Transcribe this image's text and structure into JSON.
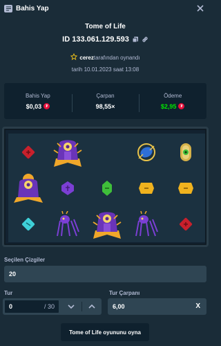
{
  "header": {
    "title": "Bahis Yap"
  },
  "game": {
    "title": "Tome of Life",
    "bet_id": "ID 133.061.129.593",
    "player_name": "cerez",
    "player_suffix": "tarafından oynandı",
    "date": "tarih 10.01.2023 saat 13:08"
  },
  "stats": {
    "bet_label": "Bahis Yap",
    "bet_value": "$0,03",
    "multiplier_label": "Çarpan",
    "multiplier_value": "98,55×",
    "payout_label": "Ödeme",
    "payout_value": "$2,95",
    "payout_color": "#00e701"
  },
  "reels": [
    [
      "red-rune",
      "scatter-book",
      "blue-rune"
    ],
    [
      "book-wild",
      "purple-rune",
      "purple-spider"
    ],
    [
      "empty",
      "green-rune",
      "book-wild"
    ],
    [
      "blue-scarab",
      "yellow-rune",
      "purple-spider"
    ],
    [
      "green-amulet",
      "yellow-rune",
      "red-rune"
    ]
  ],
  "controls": {
    "lines_label": "Seçilen Çizgiler",
    "lines_value": "20",
    "rounds_label": "Tur",
    "rounds_value": "0",
    "rounds_total": "/ 30",
    "multiplier_label": "Tur Çarpanı",
    "multiplier_value": "6,00",
    "clear_symbol": "X",
    "play_label": "Tome of Life oyununu oyna"
  }
}
